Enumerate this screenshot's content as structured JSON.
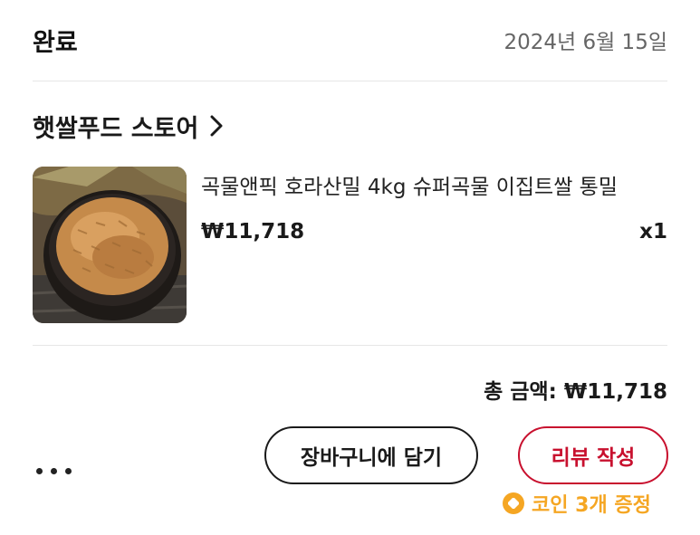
{
  "order": {
    "status": "완료",
    "date": "2024년 6월 15일"
  },
  "store": {
    "name": "햇쌀푸드 스토어"
  },
  "product": {
    "name": "곡물앤픽 호라산밀 4kg 슈퍼곡물 이집트쌀 통밀",
    "price": "₩11,718",
    "quantity": "x1"
  },
  "summary": {
    "total": "총 금액: ₩11,718"
  },
  "actions": {
    "add_to_cart": "장바구니에 담기",
    "write_review": "리뷰 작성",
    "coin_reward": "코인 3개 증정"
  },
  "colors": {
    "accent": "#c8102e",
    "coin": "#f5a623",
    "muted": "#666666"
  },
  "icons": {
    "store_chevron": "chevron-right-icon",
    "more": "more-dots-icon",
    "coin": "coin-icon"
  }
}
